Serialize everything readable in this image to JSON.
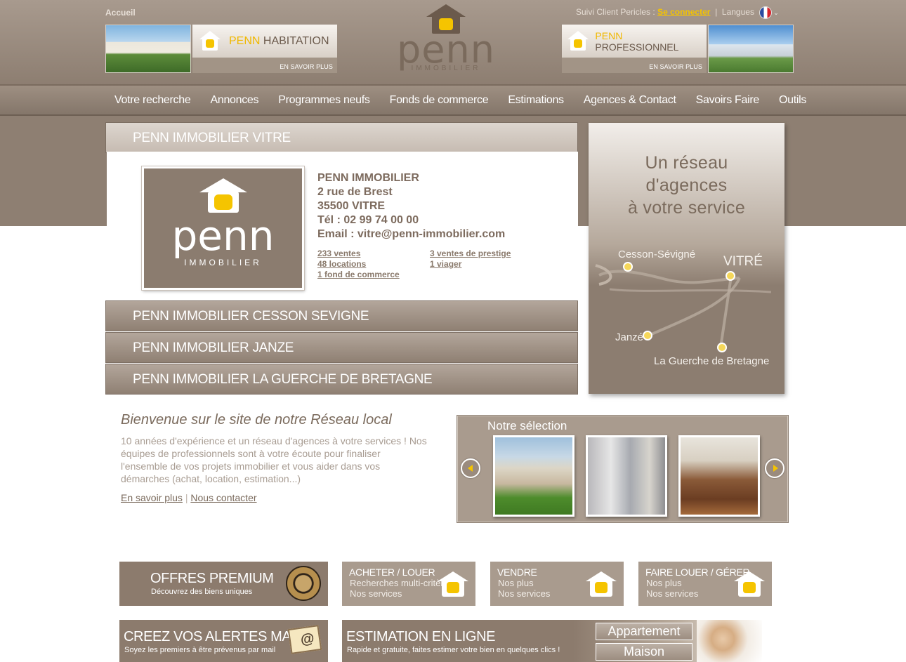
{
  "header": {
    "home_link": "Accueil",
    "client_text": "Suivi Client Pericles :",
    "login_link": "Se connecter",
    "languages": "Langues",
    "languages_sep": "|",
    "habitation": {
      "brand": "PENN",
      "label": "HABITATION",
      "more": "EN SAVOIR PLUS"
    },
    "professionnel": {
      "brand": "PENN",
      "label": "PROFESSIONNEL",
      "more": "EN SAVOIR PLUS"
    },
    "logo": {
      "word": "penn",
      "sub": "IMMOBILIER"
    }
  },
  "nav": [
    "Votre recherche",
    "Annonces",
    "Programmes neufs",
    "Fonds de commerce",
    "Estimations",
    "Agences & Contact",
    "Savoirs Faire",
    "Outils"
  ],
  "agencies": {
    "active_title": "PENN IMMOBILIER VITRE",
    "others": [
      "PENN IMMOBILIER CESSON SEVIGNE",
      "PENN IMMOBILIER JANZE",
      "PENN IMMOBILIER LA GUERCHE DE BRETAGNE"
    ],
    "logo": {
      "word": "penn",
      "sub": "IMMOBILIER"
    },
    "info": {
      "name": "PENN IMMOBILIER",
      "street": "2 rue de Brest",
      "city": "35500 VITRE",
      "phone": "Tél : 02 99 74 00 00",
      "email": "Email : vitre@penn-immobilier.com"
    },
    "stats": {
      "ventes": "233  ventes",
      "locations": "48  locations",
      "fonds": "1 fond de commerce",
      "prestige": "3 ventes de prestige",
      "viager": "1 viager"
    }
  },
  "network_panel": {
    "title_lines": [
      "Un réseau",
      "d'agences",
      "à votre service"
    ],
    "cities": [
      "Cesson-Sévigné",
      "VITRÉ",
      "Janzé",
      "La Guerche de Bretagne"
    ]
  },
  "welcome": {
    "title": "Bienvenue sur le site de notre Réseau local",
    "text": "10 années d'expérience et un réseau d'agences à votre services ! Nos équipes de professionnels sont à votre écoute pour finaliser l'ensemble de vos projets immobilier et vous aider dans vos démarches (achat, location, estimation...)",
    "link_more": "En savoir plus",
    "link_sep": "|",
    "link_contact": "Nous contacter"
  },
  "selection": {
    "title": "Notre sélection"
  },
  "services": {
    "premium": {
      "title": "OFFRES PREMIUM",
      "sub": "Découvrez des biens uniques"
    },
    "acheter": {
      "title": "ACHETER / LOUER",
      "l1": "Recherches multi-critères",
      "l2": "Nos services"
    },
    "vendre": {
      "title": "VENDRE",
      "l1": "Nos plus",
      "l2": "Nos services"
    },
    "gerer": {
      "title": "FAIRE LOUER / GÉRER",
      "l1": "Nos plus",
      "l2": "Nos services"
    },
    "alertes": {
      "title": "CREEZ VOS ALERTES MAIL",
      "sub": "Soyez les premiers à être prévenus par mail"
    },
    "estimation": {
      "title": "ESTIMATION EN LIGNE",
      "sub": "Rapide et gratuite, faites estimer votre bien en quelques clics !",
      "btn1": "Appartement",
      "btn2": "Maison"
    }
  },
  "colors": {
    "brand_brown": "#8c7b6d",
    "accent_yellow": "#f5c400"
  }
}
